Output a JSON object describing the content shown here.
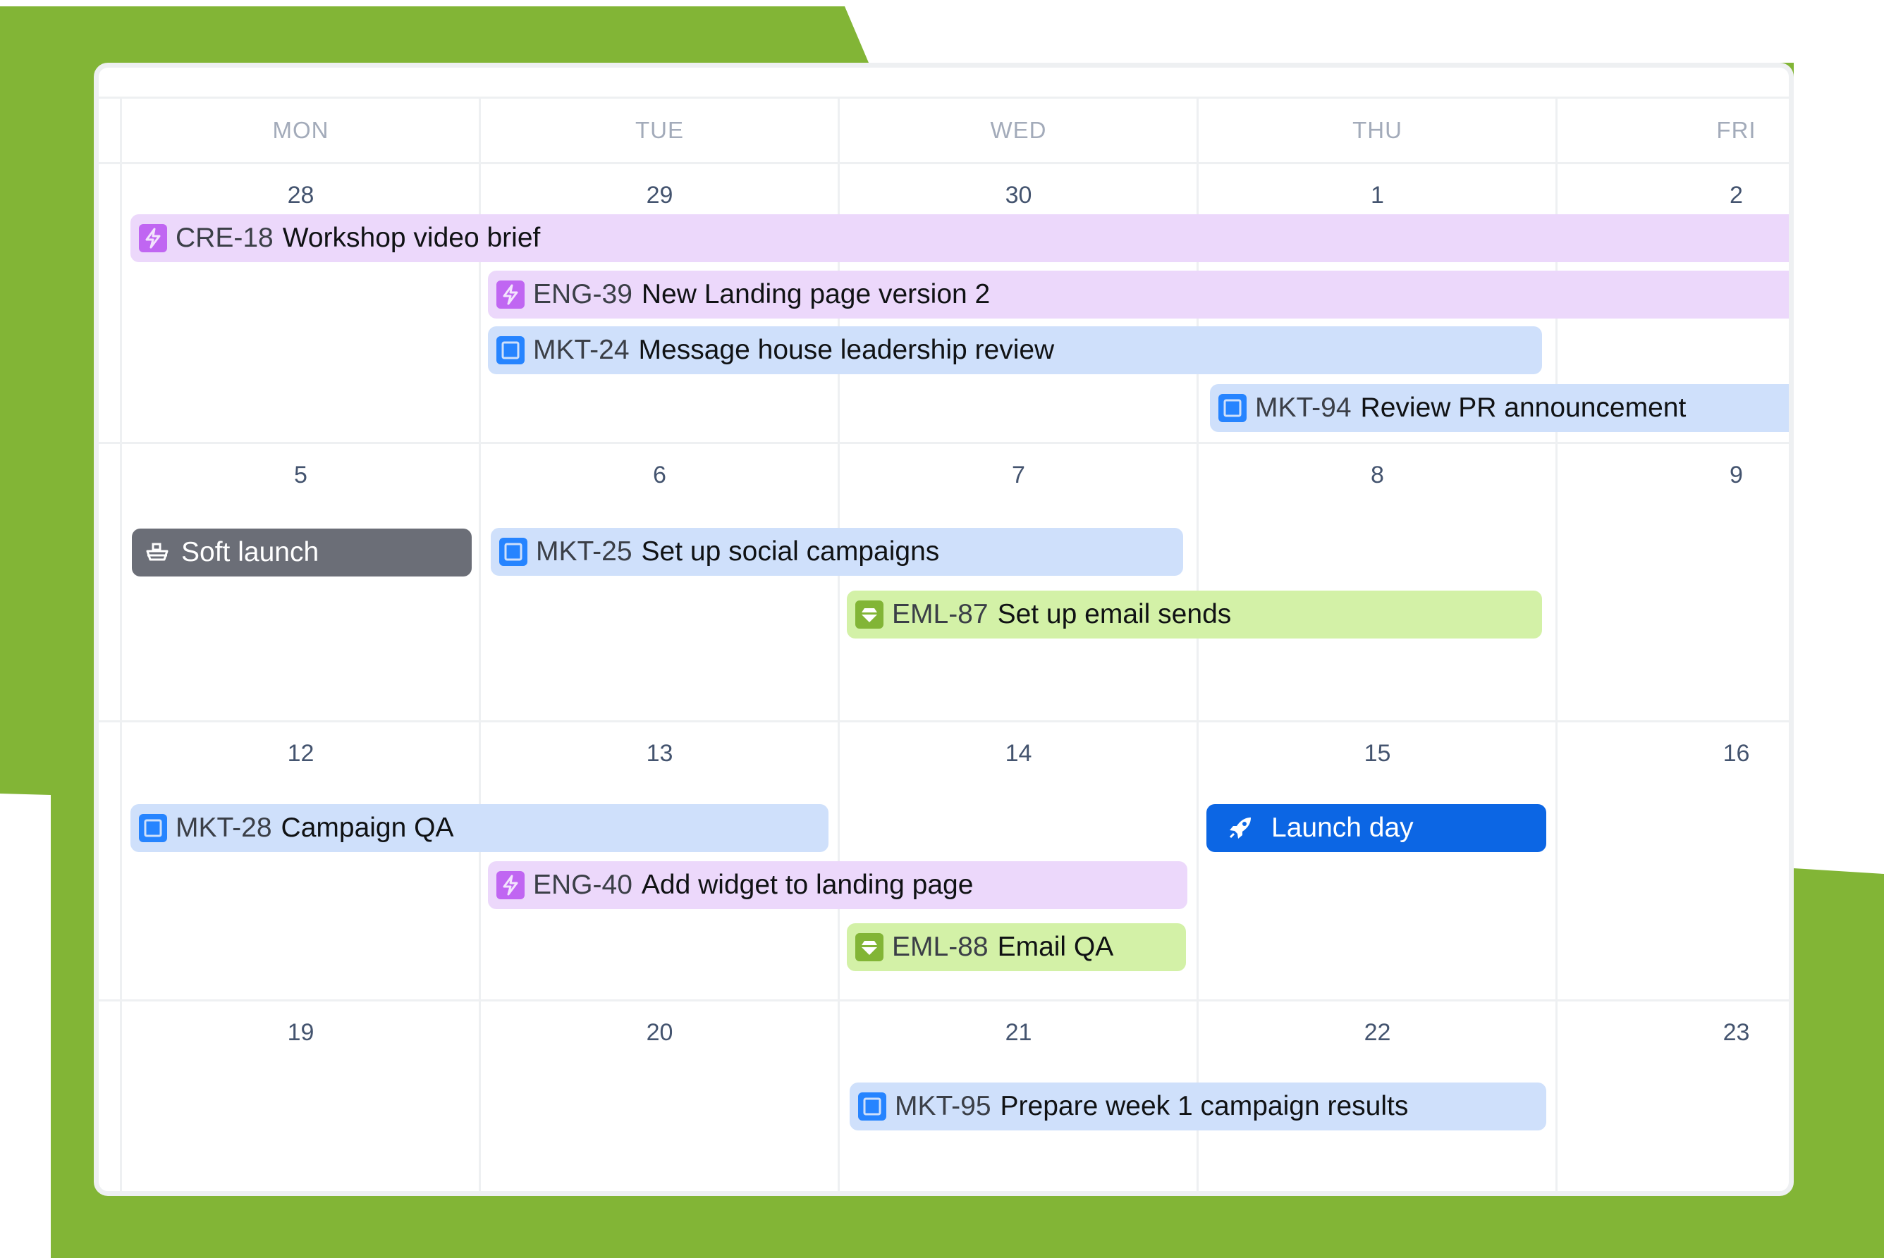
{
  "colors": {
    "background_accent": "#82b536",
    "epic_purple": "#ecd8fb",
    "task_blue": "#cfe0fb",
    "story_green": "#d3f1a7",
    "milestone_gray": "#6b6e77",
    "launch_blue": "#0c66e4"
  },
  "calendar": {
    "weekdays": [
      "MON",
      "TUE",
      "WED",
      "THU",
      "FRI"
    ],
    "weeks": [
      {
        "days": [
          "28",
          "29",
          "30",
          "1",
          "2"
        ]
      },
      {
        "days": [
          "5",
          "6",
          "7",
          "8",
          "9"
        ]
      },
      {
        "days": [
          "12",
          "13",
          "14",
          "15",
          "16"
        ]
      },
      {
        "days": [
          "19",
          "20",
          "21",
          "22",
          "23"
        ]
      }
    ],
    "events": [
      {
        "key": "CRE-18",
        "title": "Workshop video brief",
        "type": "epic",
        "icon": "lightning-icon"
      },
      {
        "key": "ENG-39",
        "title": "New Landing page version 2",
        "type": "epic",
        "icon": "lightning-icon"
      },
      {
        "key": "MKT-24",
        "title": "Message house leadership review",
        "type": "task",
        "icon": "task-square-icon"
      },
      {
        "key": "MKT-94",
        "title": "Review PR announcement",
        "type": "task",
        "icon": "task-square-icon"
      },
      {
        "key": "",
        "title": "Soft launch",
        "type": "milestone",
        "icon": "ship-icon"
      },
      {
        "key": "MKT-25",
        "title": "Set up social campaigns",
        "type": "task",
        "icon": "task-square-icon"
      },
      {
        "key": "EML-87",
        "title": "Set up email sends",
        "type": "story",
        "icon": "gem-icon"
      },
      {
        "key": "MKT-28",
        "title": "Campaign QA",
        "type": "task",
        "icon": "task-square-icon"
      },
      {
        "key": "",
        "title": "Launch day",
        "type": "milestone",
        "icon": "rocket-icon"
      },
      {
        "key": "ENG-40",
        "title": "Add widget to landing page",
        "type": "epic",
        "icon": "lightning-icon"
      },
      {
        "key": "EML-88",
        "title": "Email QA",
        "type": "story",
        "icon": "gem-icon"
      },
      {
        "key": "MKT-95",
        "title": "Prepare week 1 campaign results",
        "type": "task",
        "icon": "task-square-icon"
      }
    ]
  }
}
